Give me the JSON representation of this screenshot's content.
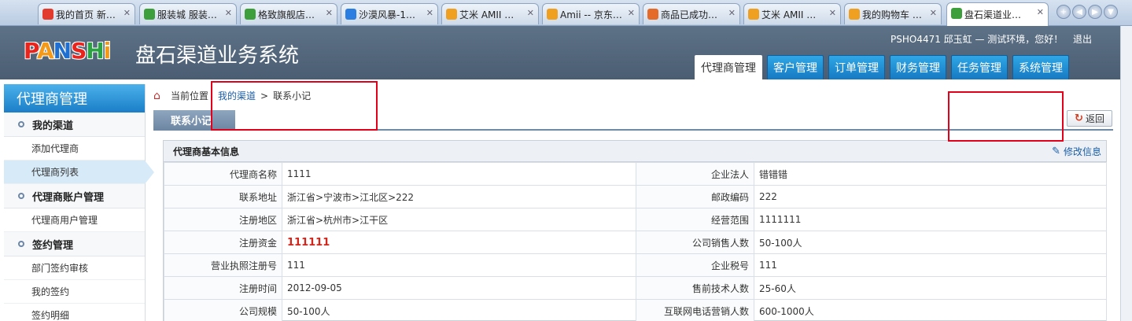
{
  "browser": {
    "tabs": [
      {
        "label": "我的首页 新…",
        "icon": "weibo-icon",
        "color": "#e23a2c"
      },
      {
        "label": "服装城 服装…",
        "icon": "ie-icon",
        "color": "#3c9f3c"
      },
      {
        "label": "格致旗舰店…",
        "icon": "ie-icon",
        "color": "#3c9f3c"
      },
      {
        "label": "沙漠风暴-1…",
        "icon": "shop-icon",
        "color": "#2a7de1"
      },
      {
        "label": "艾米 AMII …",
        "icon": "shop-icon",
        "color": "#f0a020"
      },
      {
        "label": "Amii -- 京东…",
        "icon": "shop-icon",
        "color": "#f0a020"
      },
      {
        "label": "商品已成功…",
        "icon": "page-icon",
        "color": "#e56b2a"
      },
      {
        "label": "艾米 AMII …",
        "icon": "shop-icon",
        "color": "#f0a020"
      },
      {
        "label": "我的购物车 …",
        "icon": "shop-icon",
        "color": "#f0a020"
      },
      {
        "label": "盘石渠道业…",
        "icon": "ie-icon",
        "color": "#3c9f3c",
        "active": true
      }
    ],
    "nav_buttons": [
      "+",
      "◀",
      "▶",
      "▼"
    ]
  },
  "header": {
    "logo_letters": [
      "P",
      "A",
      "N",
      "S",
      "H",
      "i"
    ],
    "logo_colors": [
      "#e8241d",
      "#f49a18",
      "#1f6fd1",
      "#e8241d",
      "#2ca343",
      "#f49a18"
    ],
    "system_title": "盘石渠道业务系统",
    "user_text": "PSHO4471 邱玉虹 — 测试环境，您好！",
    "logout": "退出",
    "tabs": [
      "代理商管理",
      "客户管理",
      "订单管理",
      "财务管理",
      "任务管理",
      "系统管理"
    ],
    "active_tab": "代理商管理"
  },
  "sidebar": {
    "title": "代理商管理",
    "groups": [
      {
        "label": "我的渠道",
        "items": [
          "添加代理商",
          "代理商列表"
        ]
      },
      {
        "label": "代理商账户管理",
        "items": [
          "代理商用户管理"
        ]
      },
      {
        "label": "签约管理",
        "items": [
          "部门签约审核",
          "我的签约",
          "签约明细"
        ]
      }
    ],
    "active_item": "代理商列表"
  },
  "breadcrumb": {
    "prefix": "当前位置",
    "link": "我的渠道",
    "sep": ">",
    "current": "联系小记"
  },
  "page_tab": "联系小记",
  "back_button": "返回",
  "panel": {
    "title": "代理商基本信息",
    "edit_link": "修改信息",
    "rows": [
      {
        "k1": "代理商名称",
        "v1": "1111",
        "k2": "企业法人",
        "v2": "错错错"
      },
      {
        "k1": "联系地址",
        "v1": "浙江省>宁波市>江北区>222",
        "k2": "邮政编码",
        "v2": "222"
      },
      {
        "k1": "注册地区",
        "v1": "浙江省>杭州市>江干区",
        "k2": "经营范围",
        "v2": "1111111"
      },
      {
        "k1": "注册资金",
        "v1": "111111",
        "k2": "公司销售人数",
        "v2": "50-100人"
      },
      {
        "k1": "营业执照注册号",
        "v1": "111",
        "k2": "企业税号",
        "v2": "111"
      },
      {
        "k1": "注册时间",
        "v1": "2012-09-05",
        "k2": "售前技术人数",
        "v2": "25-60人"
      },
      {
        "k1": "公司规模",
        "v1": "50-100人",
        "k2": "互联网电话营销人数",
        "v2": "600-1000人"
      }
    ]
  },
  "colors": {
    "highlight_box": "#e3001b",
    "header_bg": "#54687d",
    "tab_blue": "#1f8ad6"
  }
}
